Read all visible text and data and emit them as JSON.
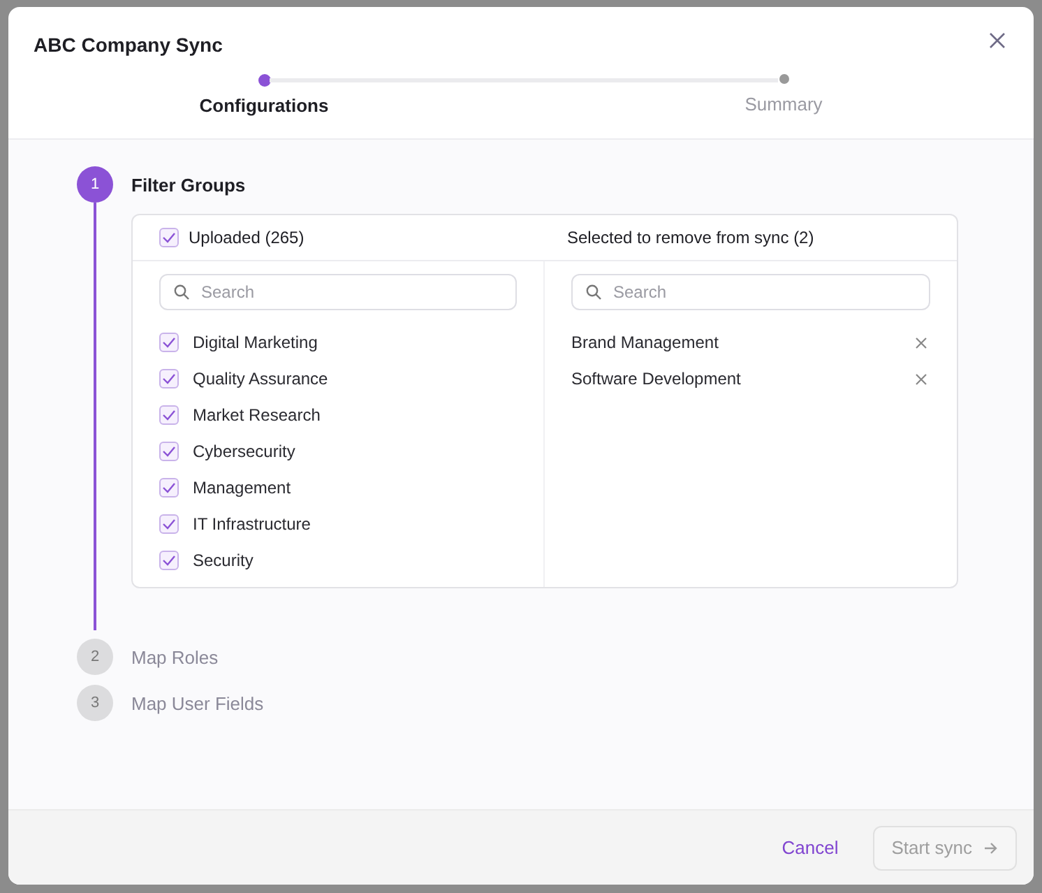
{
  "dialog": {
    "title": "ABC Company Sync"
  },
  "progress": [
    {
      "label": "Configurations",
      "selected": true
    },
    {
      "label": "Summary",
      "selected": false
    }
  ],
  "steps": [
    {
      "number": "1",
      "title": "Filter Groups",
      "expanded": true
    },
    {
      "number": "2",
      "title": "Map Roles",
      "expanded": false
    },
    {
      "number": "3",
      "title": "Map User Fields",
      "expanded": false
    }
  ],
  "filter": {
    "uploaded": {
      "label": "Uploaded (265)",
      "checked": true,
      "search_placeholder": "Search",
      "items": [
        {
          "label": "Digital Marketing",
          "checked": true
        },
        {
          "label": "Quality Assurance",
          "checked": true
        },
        {
          "label": "Market Research",
          "checked": true
        },
        {
          "label": "Cybersecurity",
          "checked": true
        },
        {
          "label": "Management",
          "checked": true
        },
        {
          "label": "IT Infrastructure",
          "checked": true
        },
        {
          "label": "Security",
          "checked": true
        }
      ]
    },
    "removed": {
      "label": "Selected to remove from sync (2)",
      "search_placeholder": "Search",
      "items": [
        "Brand Management",
        "Software Development"
      ]
    }
  },
  "footer": {
    "cancel": "Cancel",
    "start": {
      "label": "Start sync",
      "disabled": true
    }
  }
}
